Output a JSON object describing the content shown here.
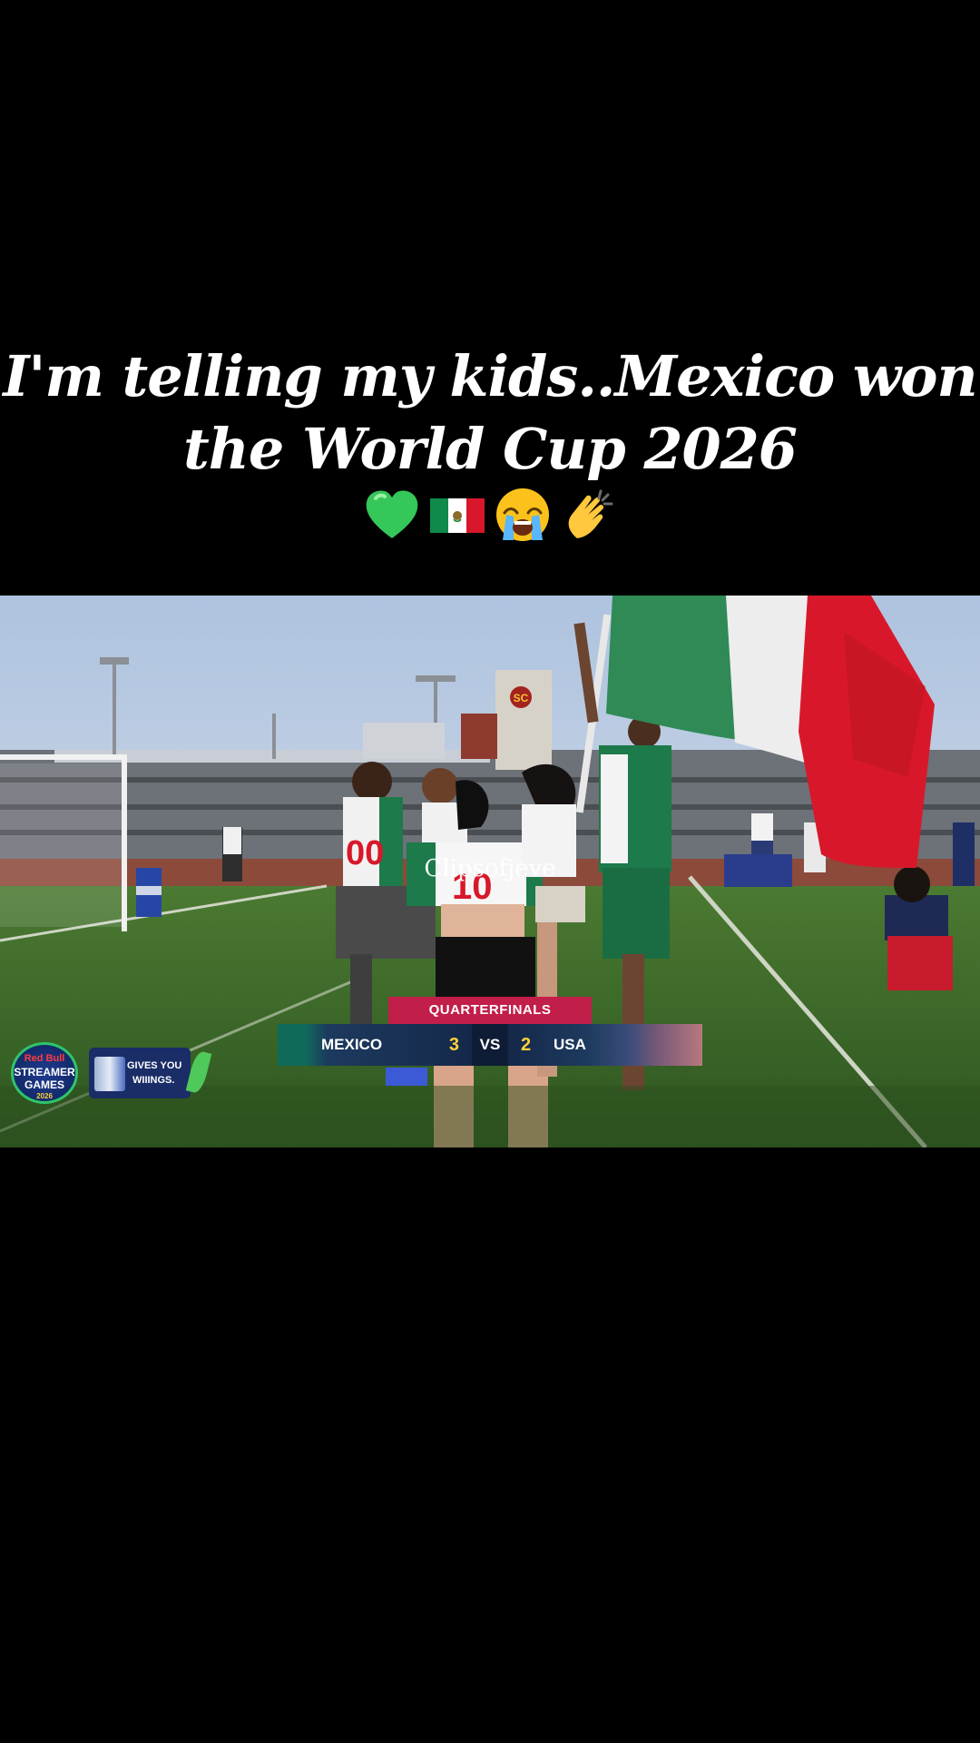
{
  "caption": {
    "line1": "I'm telling my kids..Mexico won",
    "line2": "the World Cup 2026"
  },
  "emojis": [
    "green-heart",
    "mexico-flag",
    "loudly-crying-face",
    "clapping-hands"
  ],
  "watermark": "Clipsofjeve",
  "scoreboard": {
    "round": "QUARTERFINALS",
    "home_team": "MEXICO",
    "home_score": "3",
    "separator": "VS",
    "away_score": "2",
    "away_team": "USA"
  },
  "sponsor": {
    "brand": "Red Bull",
    "event_line1": "STREAMER",
    "event_line2": "GAMES",
    "year": "2026",
    "slogan_line1": "GIVES YOU",
    "slogan_line2": "WIIINGS."
  },
  "jerseys": {
    "left_player": "00",
    "center_player": "10"
  },
  "stadium_sign": "SC",
  "colors": {
    "background": "#000000",
    "scoreboard_round": "#c21e4a",
    "score_highlight": "#ffd23a",
    "mexico_green": "#1d7a4a",
    "mexico_red": "#d8182a"
  }
}
